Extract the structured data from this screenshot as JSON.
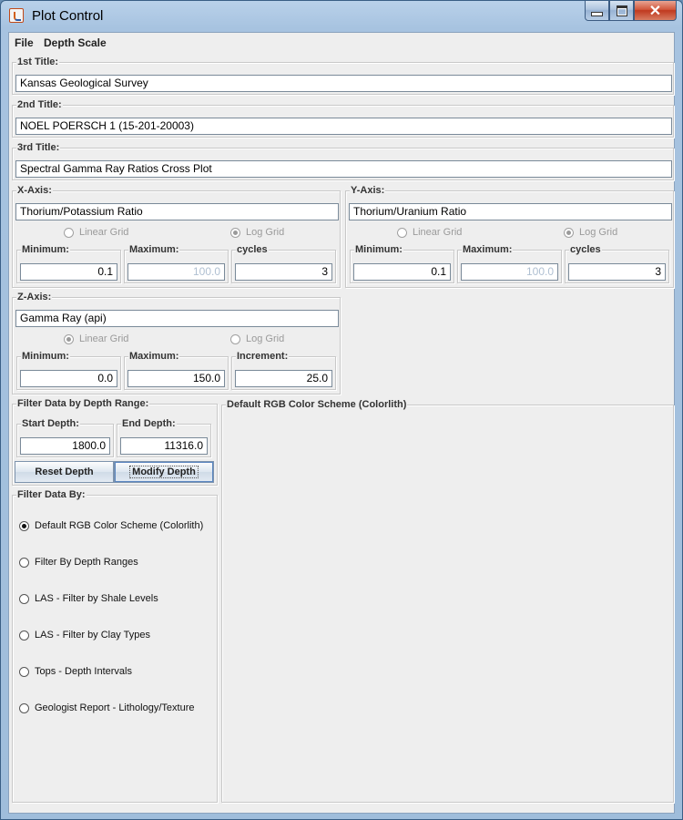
{
  "window": {
    "title": "Plot Control"
  },
  "menubar": {
    "file": "File",
    "depth_scale": "Depth Scale"
  },
  "titles": {
    "first": {
      "label": "1st Title:",
      "value": "Kansas Geological Survey"
    },
    "second": {
      "label": "2nd Title:",
      "value": "NOEL POERSCH 1 (15-201-20003)"
    },
    "third": {
      "label": "3rd Title:",
      "value": "Spectral Gamma Ray Ratios Cross Plot"
    }
  },
  "x_axis": {
    "label": "X-Axis:",
    "value": "Thorium/Potassium Ratio",
    "linear_label": "Linear Grid",
    "log_label": "Log Grid",
    "selected": "log",
    "min_label": "Minimum:",
    "min": "0.1",
    "max_label": "Maximum:",
    "max": "100.0",
    "cycles_label": "cycles",
    "cycles": "3"
  },
  "y_axis": {
    "label": "Y-Axis:",
    "value": "Thorium/Uranium Ratio",
    "linear_label": "Linear Grid",
    "log_label": "Log Grid",
    "selected": "log",
    "min_label": "Minimum:",
    "min": "0.1",
    "max_label": "Maximum:",
    "max": "100.0",
    "cycles_label": "cycles",
    "cycles": "3"
  },
  "z_axis": {
    "label": "Z-Axis:",
    "value": "Gamma Ray (api)",
    "linear_label": "Linear Grid",
    "log_label": "Log Grid",
    "selected": "linear",
    "min_label": "Minimum:",
    "min": "0.0",
    "max_label": "Maximum:",
    "max": "150.0",
    "inc_label": "Increment:",
    "inc": "25.0"
  },
  "depth_filter": {
    "label": "Filter Data by Depth Range:",
    "start_label": "Start Depth:",
    "start": "1800.0",
    "end_label": "End Depth:",
    "end": "11316.0",
    "reset": "Reset Depth",
    "modify": "Modify Depth"
  },
  "filter_by": {
    "label": "Filter Data By:",
    "options": [
      "Default RGB Color Scheme (Colorlith)",
      "Filter By Depth Ranges",
      "LAS - Filter by Shale Levels",
      "LAS - Filter by Clay Types",
      "Tops - Depth Intervals",
      "Geologist Report - Lithology/Texture"
    ],
    "selected_index": 0
  },
  "scheme_panel": {
    "label": "Default RGB Color Scheme (Colorlith)"
  },
  "icons": {
    "app": "java-icon",
    "minimize": "minimize-icon",
    "maximize": "maximize-icon",
    "close": "close-icon"
  }
}
